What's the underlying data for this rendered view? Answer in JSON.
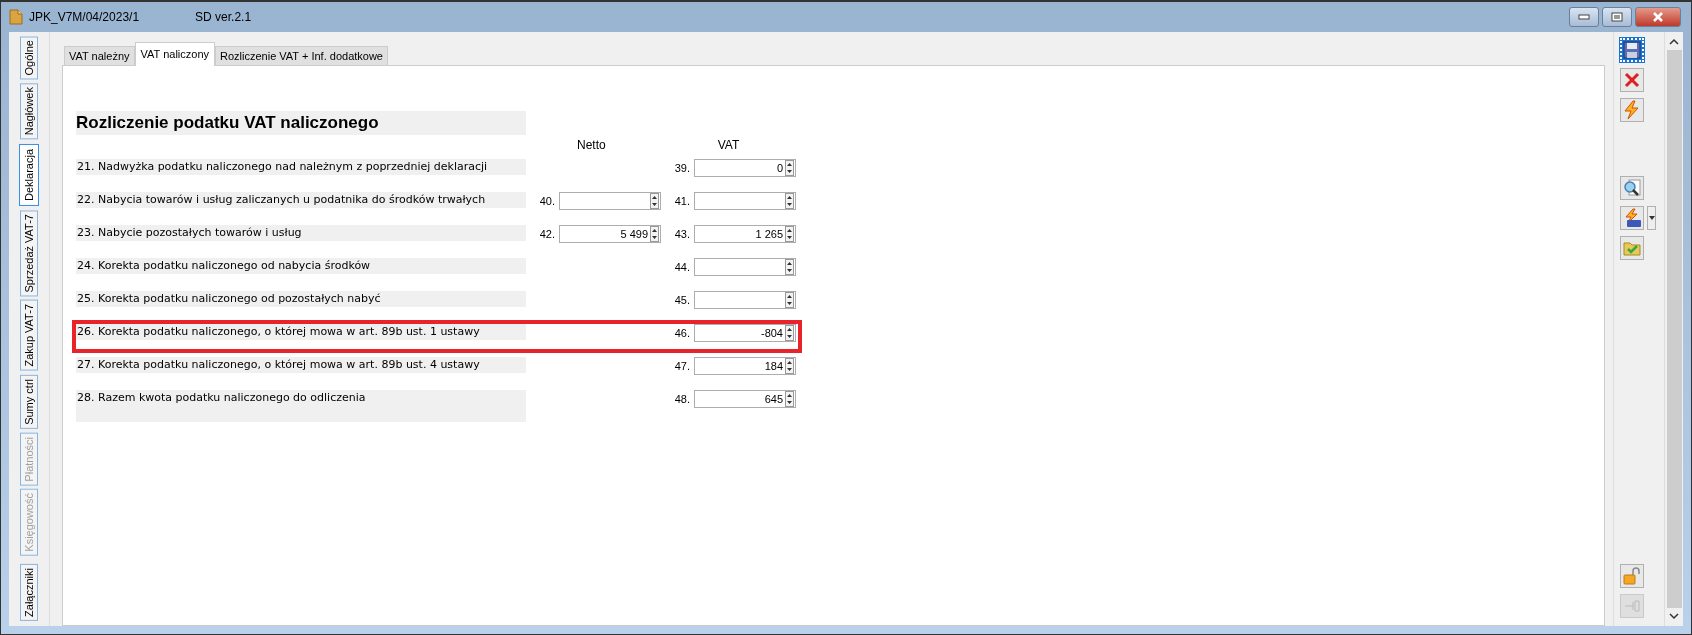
{
  "window": {
    "title": "JPK_V7M/04/2023/1",
    "subtitle": "SD ver.2.1"
  },
  "side_tabs": [
    {
      "label": "Ogólne",
      "selected": false,
      "disabled": false
    },
    {
      "label": "Nagłówek",
      "selected": false,
      "disabled": false
    },
    {
      "label": "Deklaracja",
      "selected": true,
      "disabled": false
    },
    {
      "label": "Sprzedaż VAT-7",
      "selected": false,
      "disabled": false
    },
    {
      "label": "Zakup VAT-7",
      "selected": false,
      "disabled": false
    },
    {
      "label": "Sumy ctrl",
      "selected": false,
      "disabled": false
    },
    {
      "label": "Płatności",
      "selected": false,
      "disabled": true
    },
    {
      "label": "Księgowość",
      "selected": false,
      "disabled": true
    },
    {
      "label": "Załączniki",
      "selected": false,
      "disabled": false
    }
  ],
  "tabs": [
    {
      "label": "VAT należny",
      "selected": false
    },
    {
      "label": "VAT naliczony",
      "selected": true
    },
    {
      "label": "Rozliczenie VAT + Inf. dodatkowe",
      "selected": false
    }
  ],
  "section": {
    "title": "Rozliczenie podatku VAT naliczonego",
    "columns": [
      "Netto",
      "VAT"
    ]
  },
  "rows": [
    {
      "kind": "line",
      "label": "21. Nadwyżka podatku naliczonego nad należnym z poprzedniej deklaracji",
      "vat": {
        "no": "39.",
        "value": "0"
      },
      "highlighted": false
    },
    {
      "kind": "line",
      "label": "22. Nabycia towarów i usług zaliczanych u podatnika do środków trwałych",
      "netto": {
        "no": "40."
      },
      "vat": {
        "no": "41."
      },
      "highlighted": false
    },
    {
      "kind": "line",
      "label": "23. Nabycie pozostałych towarów i usług",
      "netto": {
        "no": "42.",
        "value": "5 499"
      },
      "vat": {
        "no": "43.",
        "value": "1 265"
      },
      "highlighted": false
    },
    {
      "kind": "line",
      "label": "24.  Korekta podatku naliczonego od nabycia środków",
      "vat": {
        "no": "44."
      },
      "highlighted": false
    },
    {
      "kind": "line",
      "label": "25. Korekta podatku naliczonego od pozostałych nabyć",
      "vat": {
        "no": "45."
      },
      "highlighted": false
    },
    {
      "kind": "line",
      "label": "26. Korekta podatku naliczonego, o której mowa w art. 89b ust. 1 ustawy",
      "vat": {
        "no": "46.",
        "value": "-804"
      },
      "highlighted": true
    },
    {
      "kind": "line",
      "label": "27. Korekta podatku naliczonego, o której mowa w art. 89b ust. 4 ustawy",
      "vat": {
        "no": "47.",
        "value": "184"
      },
      "highlighted": false
    },
    {
      "kind": "total",
      "label": "28.  Razem kwota podatku naliczonego do odliczenia",
      "vat": {
        "no": "48.",
        "value": "645"
      },
      "highlighted": false
    }
  ],
  "toolbar": [
    {
      "kind": "save",
      "selected": true,
      "disabled": false
    },
    {
      "kind": "delete",
      "selected": false,
      "disabled": false
    },
    {
      "kind": "lightning",
      "selected": false,
      "disabled": false
    },
    {
      "kind": "preview",
      "selected": false,
      "disabled": false
    },
    {
      "kind": "vat",
      "selected": false,
      "disabled": false
    },
    {
      "kind": "folder",
      "selected": false,
      "disabled": false
    },
    {
      "kind": "lock",
      "selected": false,
      "disabled": false
    },
    {
      "kind": "pin",
      "selected": false,
      "disabled": true
    }
  ]
}
